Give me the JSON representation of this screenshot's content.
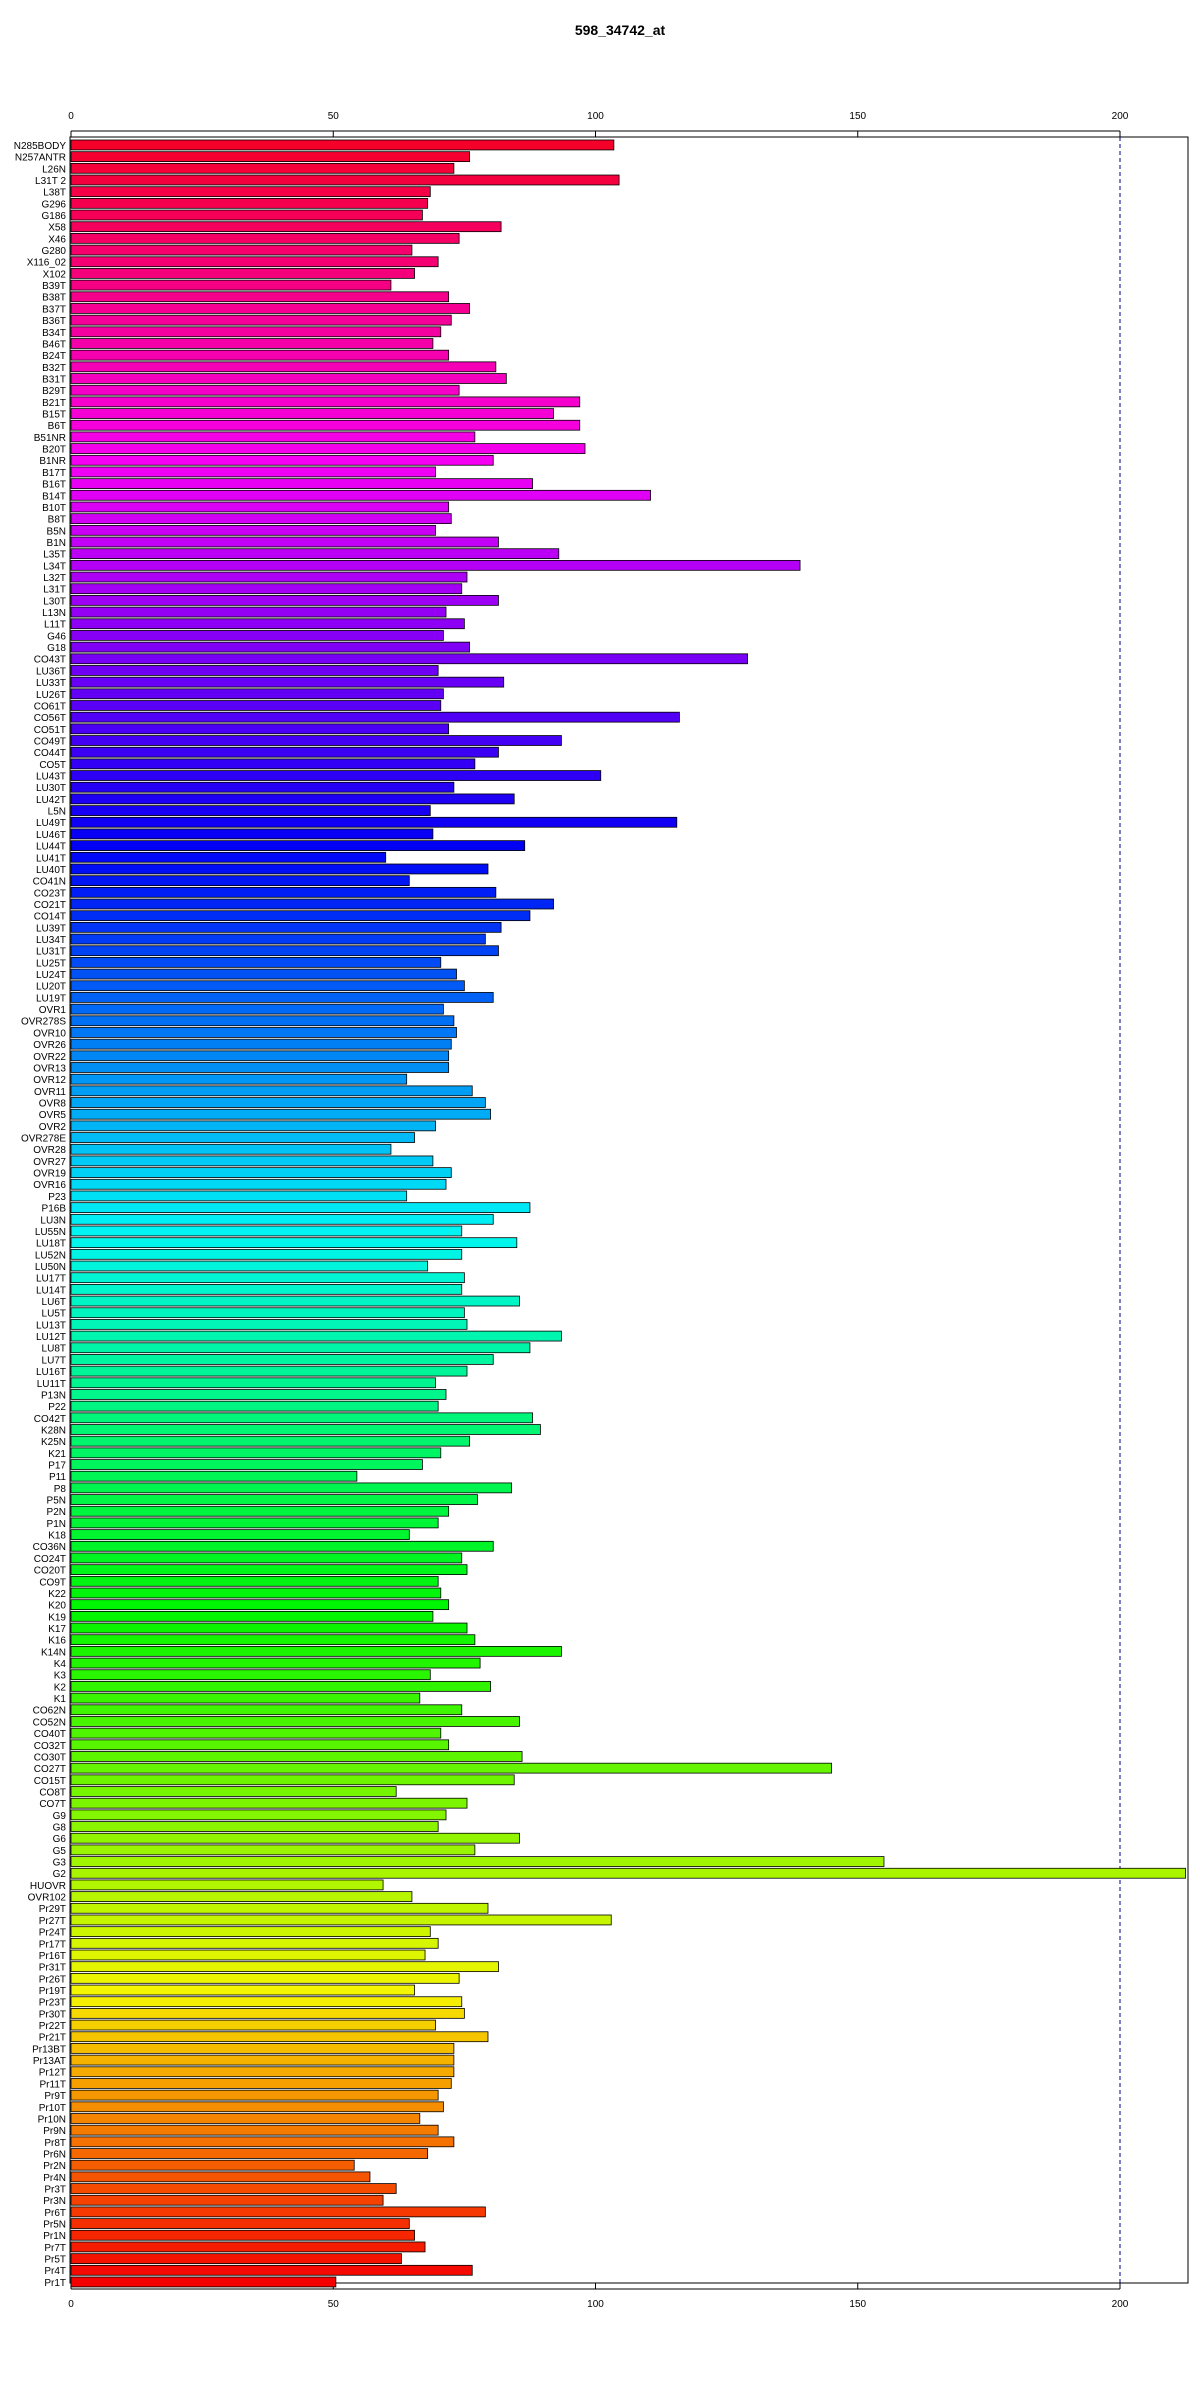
{
  "chart_data": {
    "type": "bar",
    "orientation": "horizontal",
    "title": "598_34742_at",
    "xlabel": "",
    "ylabel": "",
    "xlim": [
      0,
      212
    ],
    "xticks": [
      0,
      50,
      100,
      150,
      200
    ],
    "reference_line": 200,
    "grid": false,
    "legend": "none",
    "bar_color_scale": "rainbow from red through magenta, blue, cyan, green, yellow to orange-red",
    "categories": [
      "N285BODY",
      "N257ANTR",
      "L26N",
      "L31T 2",
      "L38T",
      "G296",
      "G186",
      "X58",
      "X46",
      "G280",
      "X116_02",
      "X102",
      "B39T",
      "B38T",
      "B37T",
      "B36T",
      "B34T",
      "B46T",
      "B24T",
      "B32T",
      "B31T",
      "B29T",
      "B21T",
      "B15T",
      "B6T",
      "B51NR",
      "B20T",
      "B1NR",
      "B17T",
      "B16T",
      "B14T",
      "B10T",
      "B8T",
      "B5N",
      "B1N",
      "L35T",
      "L34T",
      "L32T",
      "L31T",
      "L30T",
      "L13N",
      "L11T",
      "G46",
      "G18",
      "CO43T",
      "LU36T",
      "LU33T",
      "LU26T",
      "CO61T",
      "CO56T",
      "CO51T",
      "CO49T",
      "CO44T",
      "CO5T",
      "LU43T",
      "LU30T",
      "LU42T",
      "L5N",
      "LU49T",
      "LU46T",
      "LU44T",
      "LU41T",
      "LU40T",
      "CO41N",
      "CO23T",
      "CO21T",
      "CO14T",
      "LU39T",
      "LU34T",
      "LU31T",
      "LU25T",
      "LU24T",
      "LU20T",
      "LU19T",
      "OVR1",
      "OVR278S",
      "OVR10",
      "OVR26",
      "OVR22",
      "OVR13",
      "OVR12",
      "OVR11",
      "OVR8",
      "OVR5",
      "OVR2",
      "OVR278E",
      "OVR28",
      "OVR27",
      "OVR19",
      "OVR16",
      "P23",
      "P16B",
      "LU3N",
      "LU55N",
      "LU18T",
      "LU52N",
      "LU50N",
      "LU17T",
      "LU14T",
      "LU6T",
      "LU5T",
      "LU13T",
      "LU12T",
      "LU8T",
      "LU7T",
      "LU16T",
      "LU11T",
      "P13N",
      "P22",
      "CO42T",
      "K28N",
      "K25N",
      "K21",
      "P17",
      "P11",
      "P8",
      "P5N",
      "P2N",
      "P1N",
      "K18",
      "CO36N",
      "CO24T",
      "CO20T",
      "CO9T",
      "K22",
      "K20",
      "K19",
      "K17",
      "K16",
      "K14N",
      "K4",
      "K3",
      "K2",
      "K1",
      "CO62N",
      "CO52N",
      "CO40T",
      "CO32T",
      "CO30T",
      "CO27T",
      "CO15T",
      "CO8T",
      "CO7T",
      "G9",
      "G8",
      "G6",
      "G5",
      "G3",
      "G2",
      "HUOVR",
      "OVR102",
      "Pr29T",
      "Pr27T",
      "Pr24T",
      "Pr17T",
      "Pr16T",
      "Pr31T",
      "Pr26T",
      "Pr19T",
      "Pr23T",
      "Pr30T",
      "Pr22T",
      "Pr21T",
      "Pr13BT",
      "Pr13AT",
      "Pr12T",
      "Pr11T",
      "Pr9T",
      "Pr10T",
      "Pr10N",
      "Pr9N",
      "Pr8T",
      "Pr6N",
      "Pr2N",
      "Pr4N",
      "Pr3T",
      "Pr3N",
      "Pr6T",
      "Pr5N",
      "Pr1N",
      "Pr7T",
      "Pr5T",
      "Pr4T",
      "Pr1T"
    ],
    "values": [
      103.5,
      76,
      73,
      104.5,
      68.5,
      68,
      67,
      82,
      74,
      65,
      70,
      65.5,
      61,
      72,
      76,
      72.5,
      70.5,
      69,
      72,
      81,
      83,
      74,
      97,
      92,
      97,
      77,
      98,
      80.5,
      69.5,
      88,
      110.5,
      72,
      72.5,
      69.5,
      81.5,
      93,
      139,
      75.5,
      74.5,
      81.5,
      71.5,
      75,
      71,
      76,
      129,
      70,
      82.5,
      71,
      70.5,
      116,
      72,
      93.5,
      81.5,
      77,
      101,
      73,
      84.5,
      68.5,
      115.5,
      69,
      86.5,
      60,
      79.5,
      64.5,
      81,
      92,
      87.5,
      82,
      79,
      81.5,
      70.5,
      73.5,
      75,
      80.5,
      71,
      73,
      73.5,
      72.5,
      72,
      72,
      64,
      76.5,
      79,
      80,
      69.5,
      65.5,
      61,
      69,
      72.5,
      71.5,
      64,
      87.5,
      80.5,
      74.5,
      85,
      74.5,
      68,
      75,
      74.5,
      85.5,
      75,
      75.5,
      93.5,
      87.5,
      80.5,
      75.5,
      69.5,
      71.5,
      70,
      88,
      89.5,
      76,
      70.5,
      67,
      54.5,
      84,
      77.5,
      72,
      70,
      64.5,
      80.5,
      74.5,
      75.5,
      70,
      70.5,
      72,
      69,
      75.5,
      77,
      93.5,
      78,
      68.5,
      80,
      66.5,
      74.5,
      85.5,
      70.5,
      72,
      86,
      145,
      84.5,
      62,
      75.5,
      71.5,
      70,
      85.5,
      77,
      155,
      212.5,
      59.5,
      65,
      79.5,
      103,
      68.5,
      70,
      67.5,
      81.5,
      74,
      65.5,
      74.5,
      75,
      69.5,
      79.5,
      73,
      73,
      73,
      72.5,
      70,
      71,
      66.5,
      70,
      73,
      68,
      54,
      57,
      62,
      59.5,
      79,
      64.5,
      65.5,
      67.5,
      63,
      76.5,
      50.5
    ]
  }
}
